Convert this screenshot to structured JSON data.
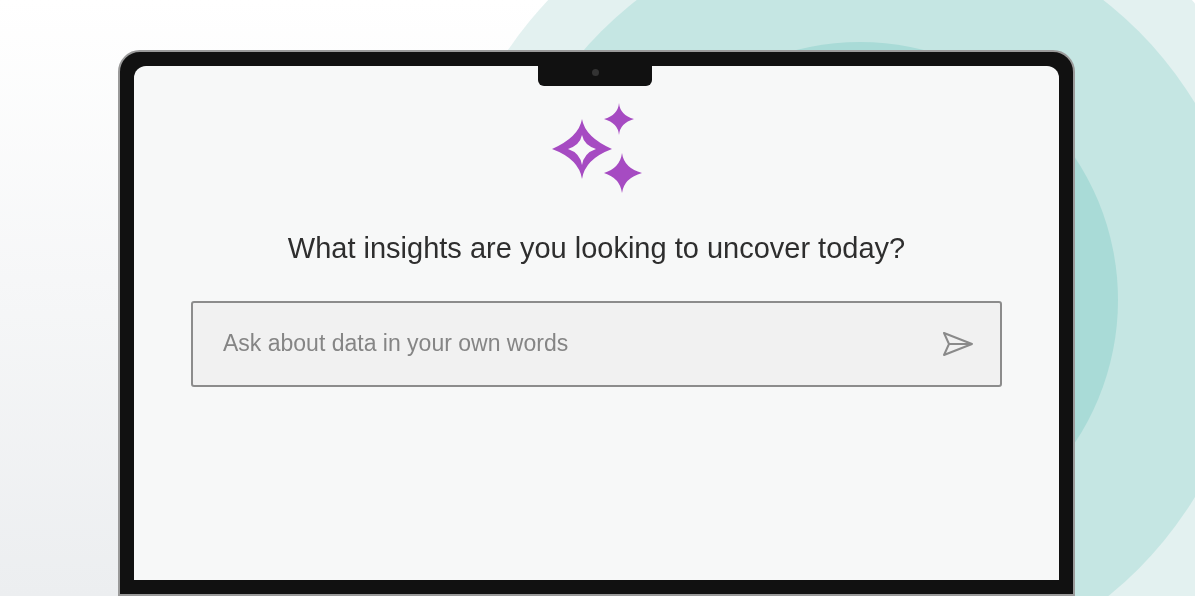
{
  "heading": "What insights are you looking to uncover today?",
  "prompt_field": {
    "placeholder": "Ask about data in your own words"
  }
}
